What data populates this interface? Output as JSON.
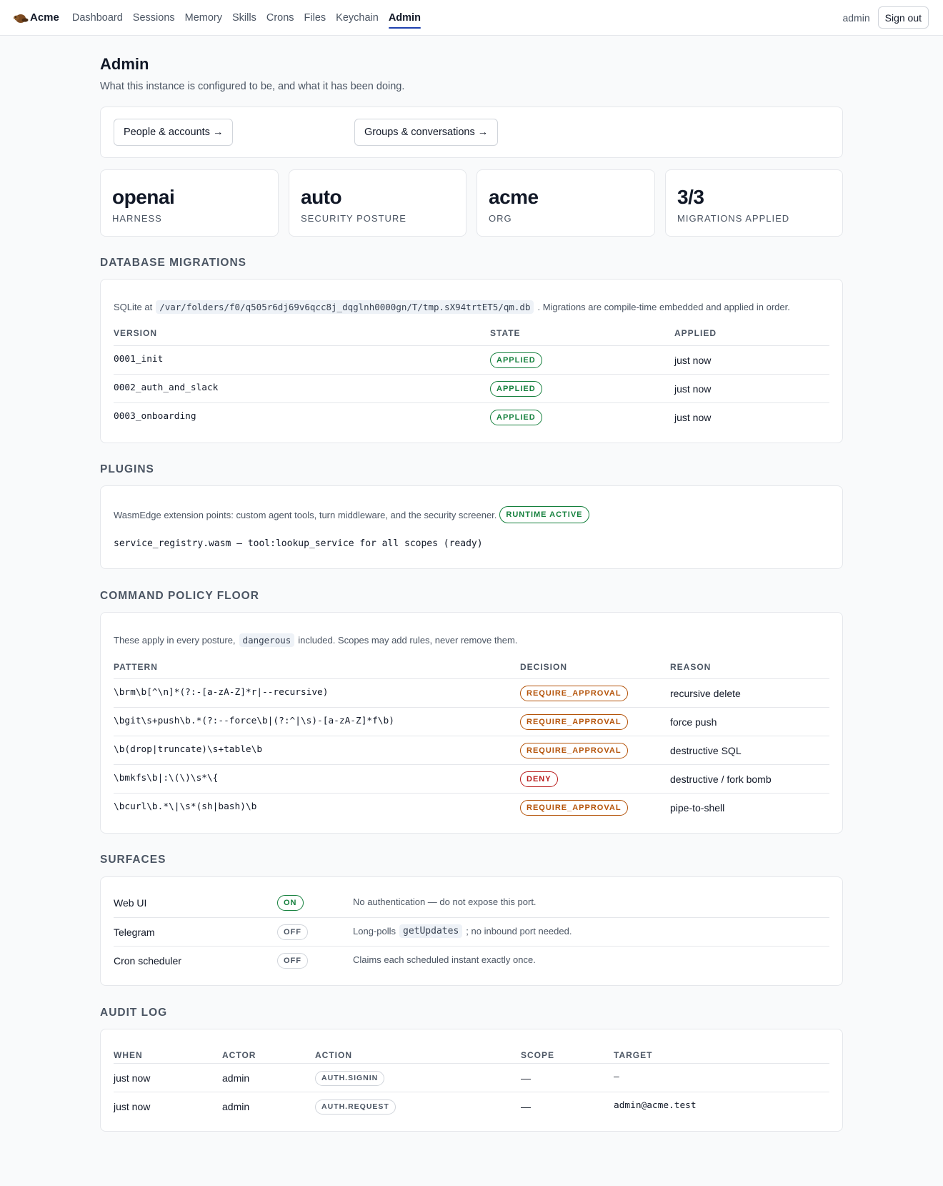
{
  "nav": {
    "brand": "Acme",
    "items": [
      "Dashboard",
      "Sessions",
      "Memory",
      "Skills",
      "Crons",
      "Files",
      "Keychain",
      "Admin"
    ],
    "active": "Admin",
    "user": "admin",
    "signout_label": "Sign out"
  },
  "page": {
    "title": "Admin",
    "subtitle": "What this instance is configured to be, and what it has been doing."
  },
  "links": {
    "people": "People & accounts →",
    "groups": "Groups & conversations →"
  },
  "stats": [
    {
      "value": "openai",
      "label": "HARNESS"
    },
    {
      "value": "auto",
      "label": "SECURITY POSTURE"
    },
    {
      "value": "acme",
      "label": "ORG"
    },
    {
      "value": "3/3",
      "label": "MIGRATIONS APPLIED"
    }
  ],
  "migrations": {
    "heading": "DATABASE MIGRATIONS",
    "intro_prefix": "SQLite at",
    "db_path": "/var/folders/f0/q505r6dj69v6qcc8j_dqglnh0000gn/T/tmp.sX94trtET5/qm.db",
    "intro_suffix": ". Migrations are compile-time embedded and applied in order.",
    "columns": [
      "VERSION",
      "STATE",
      "APPLIED"
    ],
    "rows": [
      {
        "version": "0001_init",
        "state": "APPLIED",
        "applied": "just now"
      },
      {
        "version": "0002_auth_and_slack",
        "state": "APPLIED",
        "applied": "just now"
      },
      {
        "version": "0003_onboarding",
        "state": "APPLIED",
        "applied": "just now"
      }
    ]
  },
  "plugins": {
    "heading": "PLUGINS",
    "intro": "WasmEdge extension points: custom agent tools, turn middleware, and the security screener.",
    "runtime_badge": "RUNTIME ACTIVE",
    "entry": "service_registry.wasm — tool:lookup_service for all scopes (ready)"
  },
  "policy": {
    "heading": "COMMAND POLICY FLOOR",
    "intro_prefix": "These apply in every posture,",
    "intro_code": "dangerous",
    "intro_suffix": "included. Scopes may add rules, never remove them.",
    "columns": [
      "PATTERN",
      "DECISION",
      "REASON"
    ],
    "rows": [
      {
        "pattern": "\\brm\\b[^\\n]*(?:-[a-zA-Z]*r|--recursive)",
        "decision": "REQUIRE_APPROVAL",
        "reason": "recursive delete"
      },
      {
        "pattern": "\\bgit\\s+push\\b.*(?:--force\\b|(?:^|\\s)-[a-zA-Z]*f\\b)",
        "decision": "REQUIRE_APPROVAL",
        "reason": "force push"
      },
      {
        "pattern": "\\b(drop|truncate)\\s+table\\b",
        "decision": "REQUIRE_APPROVAL",
        "reason": "destructive SQL"
      },
      {
        "pattern": "\\bmkfs\\b|:\\(\\)\\s*\\{",
        "decision": "DENY",
        "reason": "destructive / fork bomb"
      },
      {
        "pattern": "\\bcurl\\b.*\\|\\s*(sh|bash)\\b",
        "decision": "REQUIRE_APPROVAL",
        "reason": "pipe-to-shell"
      }
    ]
  },
  "surfaces": {
    "heading": "SURFACES",
    "rows": [
      {
        "name": "Web UI",
        "state": "ON",
        "note_prefix": "No authentication — do not expose this port.",
        "note_code": "",
        "note_suffix": ""
      },
      {
        "name": "Telegram",
        "state": "OFF",
        "note_prefix": "Long-polls",
        "note_code": "getUpdates",
        "note_suffix": "; no inbound port needed."
      },
      {
        "name": "Cron scheduler",
        "state": "OFF",
        "note_prefix": "Claims each scheduled instant exactly once.",
        "note_code": "",
        "note_suffix": ""
      }
    ]
  },
  "audit": {
    "heading": "AUDIT LOG",
    "columns": [
      "WHEN",
      "ACTOR",
      "ACTION",
      "SCOPE",
      "TARGET"
    ],
    "rows": [
      {
        "when": "just now",
        "actor": "admin",
        "action": "AUTH.SIGNIN",
        "scope": "—",
        "target": "—"
      },
      {
        "when": "just now",
        "actor": "admin",
        "action": "AUTH.REQUEST",
        "scope": "—",
        "target": "admin@acme.test"
      }
    ]
  },
  "colors": {
    "accent": "#1e40af",
    "applied": "#15803d",
    "require_approval": "#b45309",
    "deny": "#b91c1c"
  }
}
